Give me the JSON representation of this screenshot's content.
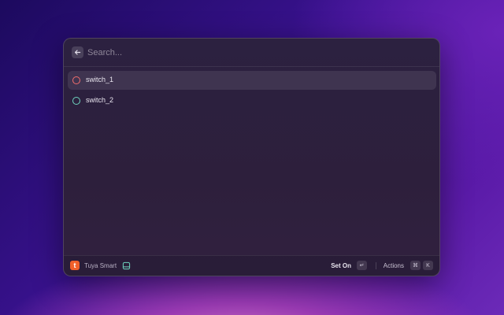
{
  "search": {
    "placeholder": "Search...",
    "value": ""
  },
  "icons": {
    "back": "arrow-left-icon",
    "extension": "tuya-logo-icon",
    "dev": "dev-mode-icon"
  },
  "list": {
    "items": [
      {
        "label": "switch_1",
        "status_color": "#f26d6d",
        "selected": true
      },
      {
        "label": "switch_2",
        "status_color": "#6ed4be",
        "selected": false
      }
    ]
  },
  "footer": {
    "extension_letter": "t",
    "extension_name": "Tuya Smart",
    "primary_action": "Set On",
    "primary_shortcut": "↵",
    "actions_label": "Actions",
    "actions_shortcut_mod": "⌘",
    "actions_shortcut_key": "K"
  },
  "colors": {
    "accent": "#f0602a",
    "dev_icon": "#6ed4be"
  }
}
